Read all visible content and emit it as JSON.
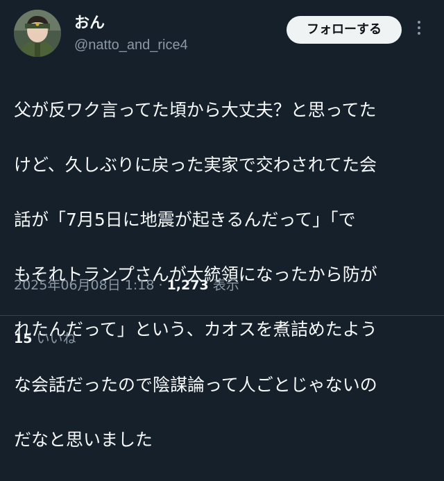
{
  "author": {
    "display_name": "おん",
    "handle": "@natto_and_rice4",
    "avatar_icon": "user-avatar"
  },
  "follow_button_label": "フォローする",
  "more_icon": "more-horizontal-icon",
  "tweet": {
    "lines": [
      "父が反ワク言ってた頃から大丈夫？と思ってた",
      "けど、久しぶりに戻った実家で交わされてた会",
      "話が「7月5日に地震が起きるんだって」「で",
      "もそれトランプさんが大統領になったから防が",
      "れたんだって」という、カオスを煮詰めたよう",
      "な会話だったので陰謀論って人ごとじゃないの",
      "だなと思いました"
    ],
    "timestamp": "2025年06月08日 1:18",
    "separator": "·",
    "views_count": "1,273",
    "views_label": "表示"
  },
  "engagement": {
    "likes_count": "15",
    "likes_label": "いいね"
  },
  "colors": {
    "background": "#15202b",
    "text_primary": "#f7f9f9",
    "text_secondary": "#8b98a5",
    "button_bg": "#eff3f4",
    "divider": "#38444d"
  }
}
